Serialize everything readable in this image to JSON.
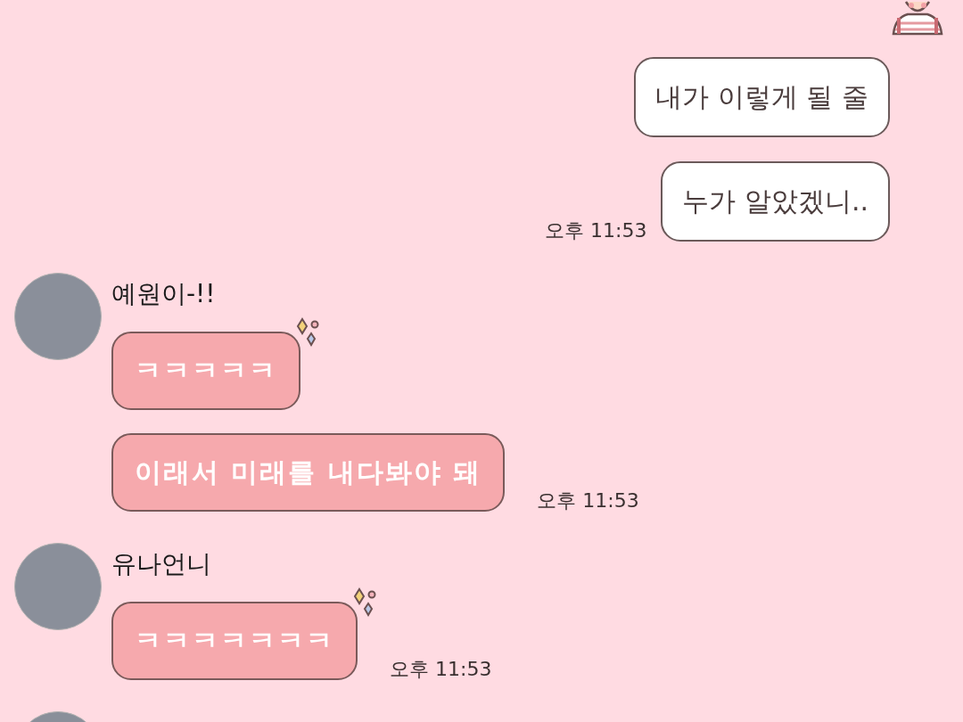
{
  "groups": [
    {
      "kind": "outgoing",
      "messages": [
        {
          "text": "내가 이렇게 될 줄"
        },
        {
          "text": "누가 알았겠니.."
        }
      ],
      "time": "오후 11:53"
    },
    {
      "kind": "incoming",
      "sender": "예원이-!!",
      "messages": [
        {
          "text": "ㅋㅋㅋㅋㅋ",
          "sparkle": true
        },
        {
          "text": "이래서 미래를 내다봐야 돼",
          "sparkle": false
        }
      ],
      "time": "오후 11:53"
    },
    {
      "kind": "incoming",
      "sender": "유나언니",
      "messages": [
        {
          "text": "ㅋㅋㅋㅋㅋㅋㅋ",
          "sparkle": true
        }
      ],
      "time": "오후 11:53"
    },
    {
      "kind": "incoming"
    }
  ]
}
